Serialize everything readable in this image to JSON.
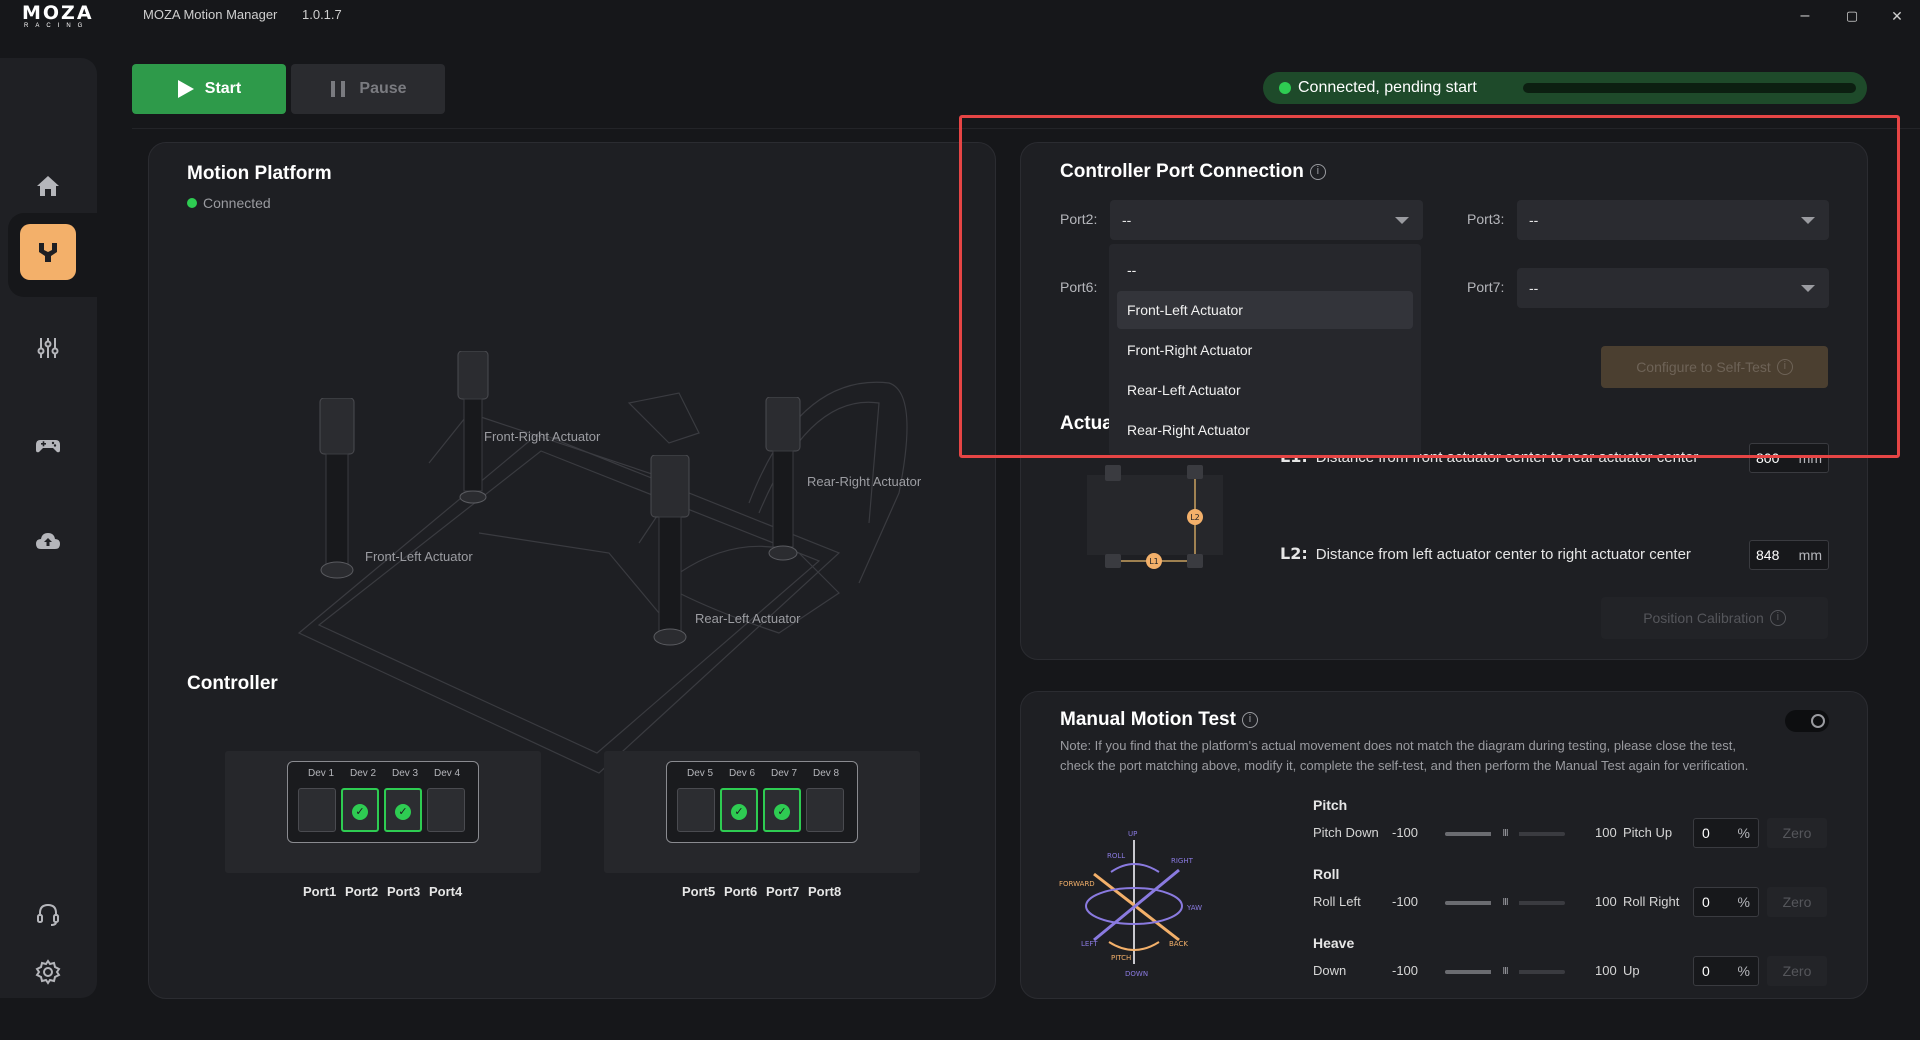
{
  "app": {
    "brand": "MOZA",
    "brand_sub": "RACING",
    "title": "MOZA Motion Manager",
    "version": "1.0.1.7"
  },
  "window_controls": {
    "minimize": "–",
    "maximize": "▢",
    "close": "✕"
  },
  "sidebar": {
    "items": [
      {
        "name": "home",
        "icon": "home-icon"
      },
      {
        "name": "motion",
        "icon": "motion-platform-icon",
        "active": true
      },
      {
        "name": "tuning",
        "icon": "sliders-icon"
      },
      {
        "name": "games",
        "icon": "gamepad-icon"
      },
      {
        "name": "cloud",
        "icon": "cloud-upload-icon"
      },
      {
        "name": "support",
        "icon": "headset-icon"
      },
      {
        "name": "settings",
        "icon": "gear-icon"
      }
    ],
    "accent": "#f3b06a"
  },
  "toolbar": {
    "start_label": "Start",
    "pause_label": "Pause"
  },
  "status": {
    "text": "Connected, pending start",
    "color": "#2ecc52"
  },
  "motion_platform": {
    "title": "Motion Platform",
    "status": "Connected",
    "actuators": {
      "front_right": "Front-Right Actuator",
      "front_left": "Front-Left Actuator",
      "rear_right": "Rear-Right Actuator",
      "rear_left": "Rear-Left Actuator"
    }
  },
  "controller": {
    "title": "Controller",
    "box1": {
      "devs": [
        "Dev 1",
        "Dev 2",
        "Dev 3",
        "Dev 4"
      ],
      "ports": [
        "Port1",
        "Port2",
        "Port3",
        "Port4"
      ],
      "connected": [
        false,
        true,
        true,
        false
      ]
    },
    "box2": {
      "devs": [
        "Dev 5",
        "Dev 6",
        "Dev 7",
        "Dev 8"
      ],
      "ports": [
        "Port5",
        "Port6",
        "Port7",
        "Port8"
      ],
      "connected": [
        false,
        true,
        true,
        false
      ]
    }
  },
  "port_connection": {
    "title": "Controller Port Connection",
    "fields": {
      "port2": {
        "label": "Port2:",
        "value": "--"
      },
      "port3": {
        "label": "Port3:",
        "value": "--"
      },
      "port6": {
        "label": "Port6:"
      },
      "port7": {
        "label": "Port7:",
        "value": "--"
      }
    },
    "dropdown_options": [
      "--",
      "Front-Left Actuator",
      "Front-Right Actuator",
      "Rear-Left Actuator",
      "Rear-Right Actuator"
    ],
    "configure_button": "Configure to Self-Test"
  },
  "actuator_section": {
    "title_partial": "Actua",
    "l1": {
      "tag": "L1:",
      "text": "Distance from front actuator center to rear actuator center",
      "value": "800",
      "unit": "mm"
    },
    "l2": {
      "tag": "L2:",
      "text": "Distance from left actuator center to right actuator center",
      "value": "848",
      "unit": "mm"
    },
    "diagram_l1": "L1",
    "diagram_l2": "L2",
    "calibration_button": "Position Calibration"
  },
  "manual_test": {
    "title": "Manual Motion Test",
    "note": "Note: If you find that the platform's actual movement does not match the diagram during testing, please close the test, check the port matching above, modify it, complete the self-test, and then perform the Manual Test again for verification.",
    "diagram_labels": {
      "up": "UP",
      "roll": "ROLL",
      "right": "RIGHT",
      "forward": "FORWARD",
      "yaw": "YAW",
      "left": "LEFT",
      "pitch": "PITCH",
      "back": "BACK",
      "down": "DOWN"
    },
    "axes": [
      {
        "title": "Pitch",
        "min_label": "Pitch Down",
        "min": "-100",
        "max": "100",
        "max_label": "Pitch Up",
        "value": "0",
        "unit": "%",
        "zero": "Zero",
        "level": 0.5
      },
      {
        "title": "Roll",
        "min_label": "Roll Left",
        "min": "-100",
        "max": "100",
        "max_label": "Roll Right",
        "value": "0",
        "unit": "%",
        "zero": "Zero",
        "level": 0.5
      },
      {
        "title": "Heave",
        "min_label": "Down",
        "min": "-100",
        "max": "100",
        "max_label": "Up",
        "value": "0",
        "unit": "%",
        "zero": "Zero",
        "level": 0.5
      }
    ]
  }
}
